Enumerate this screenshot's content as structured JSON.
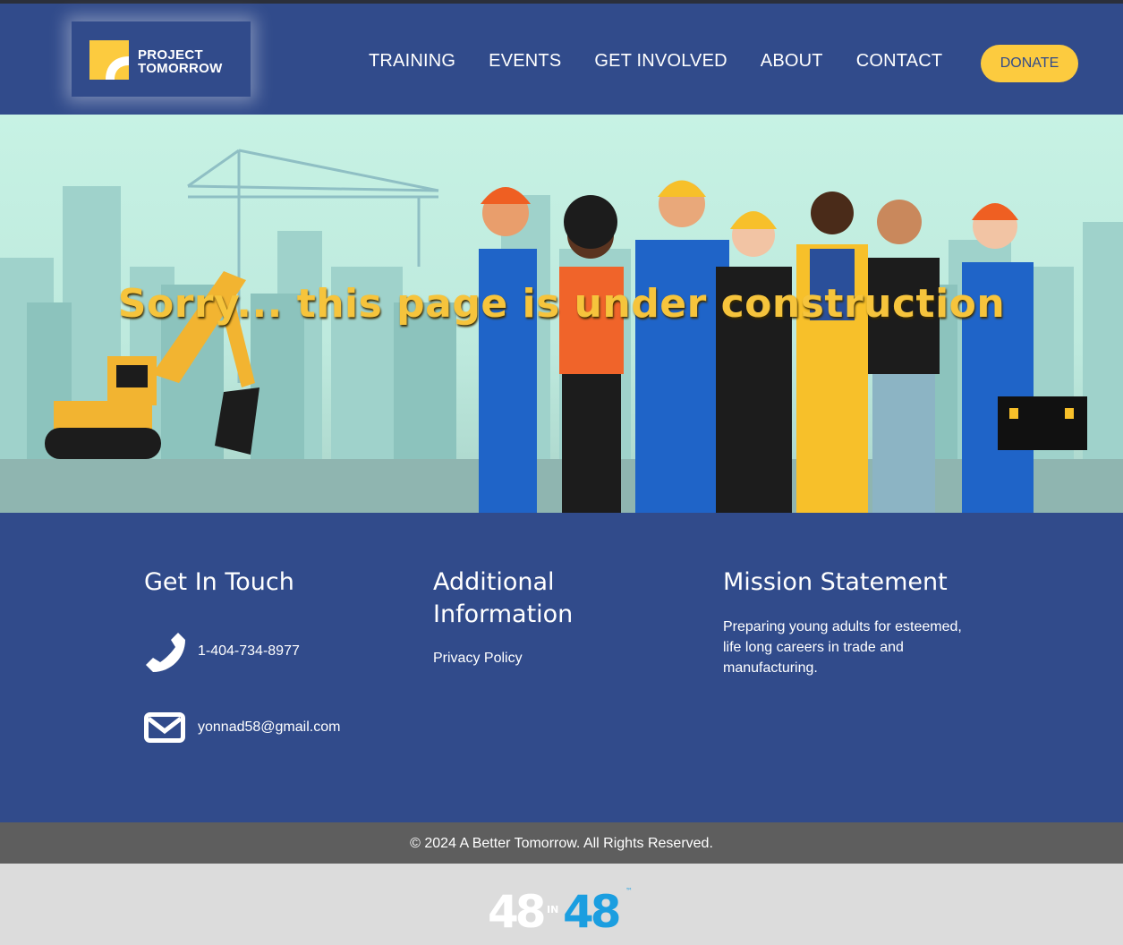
{
  "header": {
    "logo_line1": "PROJECT",
    "logo_line2": "TOMORROW",
    "nav": [
      "TRAINING",
      "EVENTS",
      "GET INVOLVED",
      "ABOUT",
      "CONTACT"
    ],
    "donate": "DONATE"
  },
  "hero": {
    "title": "Sorry... this page is under construction"
  },
  "footer": {
    "get_in_touch": {
      "heading": "Get In Touch",
      "phone": "1-404-734-8977",
      "email": "yonnad58@gmail.com"
    },
    "additional": {
      "heading_line1": "Additional",
      "heading_line2": "Information",
      "link": "Privacy Policy"
    },
    "mission": {
      "heading": "Mission Statement",
      "text": "Preparing young adults for esteemed, life long careers in trade and manufacturing."
    }
  },
  "copyright": "© 2024 A Better Tomorrow. All Rights Reserved.",
  "badge": {
    "left": "48",
    "middle": "IN",
    "right": "48",
    "tm": "™"
  },
  "colors": {
    "brand_blue": "#314b8b",
    "accent_yellow": "#fccb3f",
    "copyright_bar": "#5e5e5e"
  }
}
